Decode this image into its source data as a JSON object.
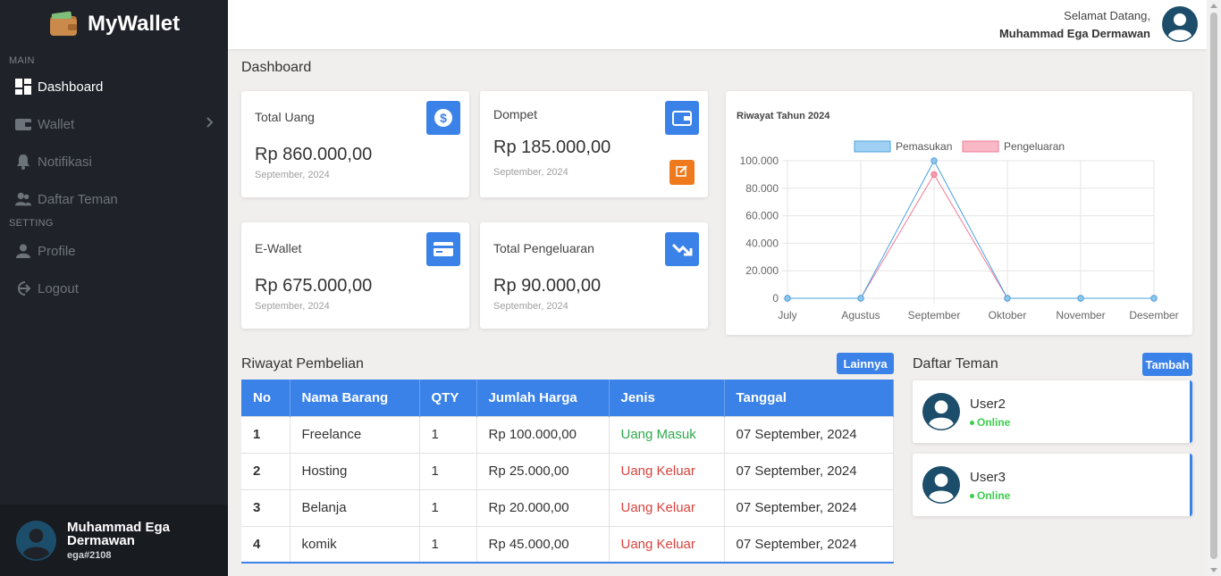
{
  "app": {
    "name": "MyWallet"
  },
  "sidebar": {
    "sections": {
      "main": "MAIN",
      "setting": "SETTING"
    },
    "items": [
      {
        "label": "Dashboard",
        "icon": "dashboard-icon",
        "active": true
      },
      {
        "label": "Wallet",
        "icon": "wallet-icon",
        "has_submenu": true
      },
      {
        "label": "Notifikasi",
        "icon": "bell-icon"
      },
      {
        "label": "Daftar Teman",
        "icon": "users-icon"
      },
      {
        "label": "Profile",
        "icon": "user-icon"
      },
      {
        "label": "Logout",
        "icon": "logout-icon"
      }
    ],
    "profile": {
      "name": "Muhammad Ega Dermawan",
      "tag": "ega#2108"
    }
  },
  "header": {
    "greeting": "Selamat Datang,",
    "user_name": "Muhammad Ega Dermawan"
  },
  "page": {
    "title": "Dashboard"
  },
  "cards": [
    {
      "label": "Total Uang",
      "value": "Rp 860.000,00",
      "date": "September, 2024",
      "icon": "dollar-icon"
    },
    {
      "label": "Dompet",
      "value": "Rp 185.000,00",
      "date": "September, 2024",
      "icon": "wallet-icon"
    },
    {
      "label": "E-Wallet",
      "value": "Rp 675.000,00",
      "date": "September, 2024",
      "icon": "credit-card-icon"
    },
    {
      "label": "Total Pengeluaran",
      "value": "Rp 90.000,00",
      "date": "September, 2024",
      "icon": "trend-down-icon"
    }
  ],
  "chart_data": {
    "type": "line",
    "title": "Riwayat Tahun 2024",
    "categories": [
      "July",
      "Agustus",
      "September",
      "Oktober",
      "November",
      "Desember"
    ],
    "series": [
      {
        "name": "Pemasukan",
        "values": [
          0,
          0,
          100000,
          0,
          0,
          0
        ],
        "color": "#4aa3df"
      },
      {
        "name": "Pengeluaran",
        "values": [
          0,
          0,
          90000,
          0,
          0,
          0
        ],
        "color": "#f07a95"
      }
    ],
    "yticks": [
      "0",
      "20.000",
      "40.000",
      "60.000",
      "80.000",
      "100.000"
    ],
    "ylim": [
      0,
      100000
    ],
    "legend": "top",
    "grid": true
  },
  "purchases": {
    "title": "Riwayat Pembelian",
    "more_label": "Lainnya",
    "columns": [
      "No",
      "Nama Barang",
      "QTY",
      "Jumlah Harga",
      "Jenis",
      "Tanggal"
    ],
    "rows": [
      {
        "no": "1",
        "name": "Freelance",
        "qty": "1",
        "price": "Rp 100.000,00",
        "type": "Uang Masuk",
        "date": "07 September, 2024"
      },
      {
        "no": "2",
        "name": "Hosting",
        "qty": "1",
        "price": "Rp 25.000,00",
        "type": "Uang Keluar",
        "date": "07 September, 2024"
      },
      {
        "no": "3",
        "name": "Belanja",
        "qty": "1",
        "price": "Rp 20.000,00",
        "type": "Uang Keluar",
        "date": "07 September, 2024"
      },
      {
        "no": "4",
        "name": "komik",
        "qty": "1",
        "price": "Rp 45.000,00",
        "type": "Uang Keluar",
        "date": "07 September, 2024"
      }
    ]
  },
  "friends": {
    "title": "Daftar Teman",
    "add_label": "Tambah",
    "list": [
      {
        "name": "User2",
        "status": "Online"
      },
      {
        "name": "User3",
        "status": "Online"
      }
    ]
  }
}
